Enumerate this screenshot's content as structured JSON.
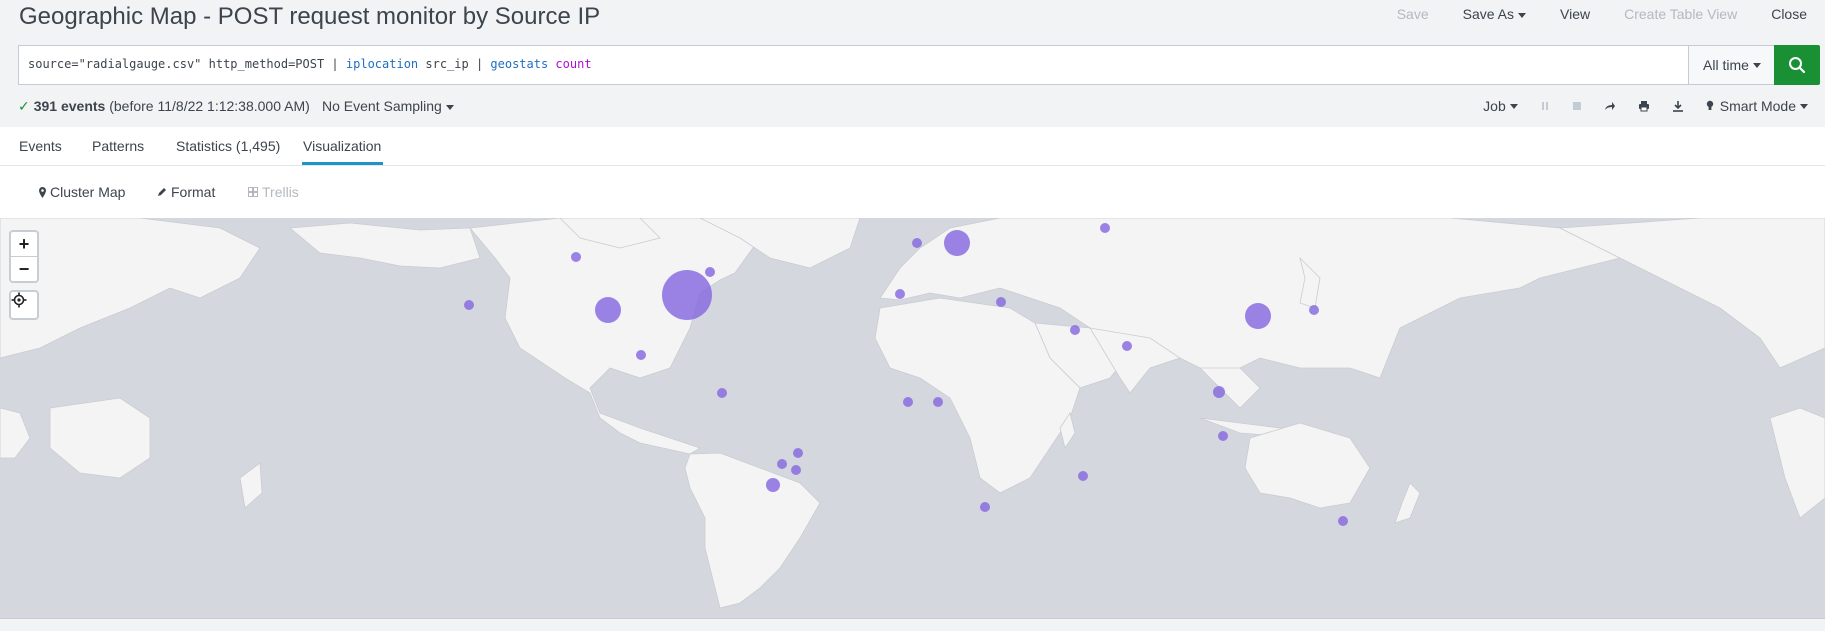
{
  "header": {
    "title": "Geographic Map - POST request monitor by Source IP",
    "actions": {
      "save": "Save",
      "save_as": "Save As",
      "view": "View",
      "create_table_view": "Create Table View",
      "close": "Close"
    }
  },
  "search": {
    "query_part1": "source=\"radialgauge.csv\" http_method=POST | ",
    "cmd_iplocation": "iplocation",
    "query_part2": " src_ip | ",
    "cmd_geostats": "geostats",
    "query_space": " ",
    "fn_count": "count",
    "time_range": "All time",
    "search_icon": "magnifier-icon"
  },
  "status": {
    "check": "✓",
    "events_count": "391 events",
    "events_detail": "(before 11/8/22 1:12:38.000 AM)",
    "sampling": "No Event Sampling",
    "job": "Job",
    "mode": "Smart Mode"
  },
  "tabs": {
    "events": "Events",
    "patterns": "Patterns",
    "statistics": "Statistics (1,495)",
    "visualization": "Visualization"
  },
  "viz_toolbar": {
    "cluster_map": "Cluster Map",
    "format": "Format",
    "trellis": "Trellis"
  },
  "map": {
    "zoom_in": "+",
    "zoom_out": "−",
    "marker_color": "#8a6de0",
    "background_color": "#d4d8de",
    "land_color": "#f4f4f4"
  },
  "colors": {
    "accent": "#1e93c6",
    "search_button": "#1a9035",
    "success": "#1a9035"
  }
}
